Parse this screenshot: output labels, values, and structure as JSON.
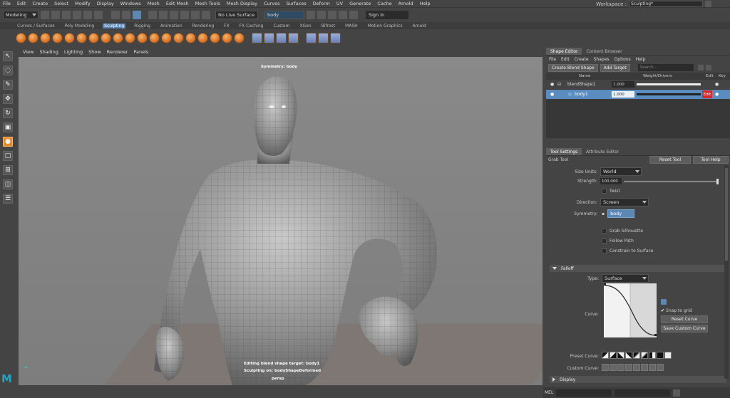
{
  "menubar": {
    "items": [
      "File",
      "Edit",
      "Create",
      "Select",
      "Modify",
      "Display",
      "Windows",
      "Mesh",
      "Edit Mesh",
      "Mesh Tools",
      "Mesh Display",
      "Curves",
      "Surfaces",
      "Deform",
      "UV",
      "Generate",
      "Cache",
      "Arnold",
      "Help"
    ],
    "workspace_label": "Workspace :",
    "workspace_value": "Sculpting*"
  },
  "statusline": {
    "mode": "Modeling",
    "live_surface": "No Live Surface",
    "symmetry_field": "body",
    "signin": "Sign In"
  },
  "shelf": {
    "tabs": [
      "Curves / Surfaces",
      "Poly Modeling",
      "Sculpting",
      "Rigging",
      "Animation",
      "Rendering",
      "FX",
      "FX Caching",
      "Custom",
      "XGen",
      "Bifrost",
      "MASH",
      "Motion Graphics",
      "Arnold"
    ],
    "active_tab": "Sculpting"
  },
  "viewport": {
    "menu": [
      "View",
      "Shading",
      "Lighting",
      "Show",
      "Renderer",
      "Panels"
    ],
    "hud_top": "Symmetry: body",
    "hud_line1": "Editing blend shape target: body1",
    "hud_line2": "Sculpting on: bodyShapeDeformed",
    "hud_line3": "persp"
  },
  "shape_editor": {
    "tabs": [
      "Shape Editor",
      "Content Browser"
    ],
    "menu": [
      "File",
      "Edit",
      "Create",
      "Shapes",
      "Options",
      "Help"
    ],
    "create_blend_shape": "Create Blend Shape",
    "add_target": "Add Target",
    "search_placeholder": "Search...",
    "col_name": "Name",
    "col_weight": "Weight/Drivers",
    "col_edit": "Edit",
    "col_key": "Key",
    "rows": [
      {
        "name": "blendShape1",
        "weight": "1.000"
      },
      {
        "name": "body1",
        "weight": "1.000",
        "edit": "Edit"
      }
    ]
  },
  "tool_settings": {
    "tabs": [
      "Tool Settings",
      "Attribute Editor"
    ],
    "tool_name": "Grab Tool",
    "reset_tool": "Reset Tool",
    "tool_help": "Tool Help",
    "size_units_label": "Size Units:",
    "size_units_value": "World",
    "strength_label": "Strength:",
    "strength_value": "100.000",
    "twist": "Twist",
    "direction_label": "Direction:",
    "direction_value": "Screen",
    "symmetry_label": "Symmetry:",
    "symmetry_value": "body",
    "grab_silhouette": "Grab Silhouette",
    "follow_path": "Follow Path",
    "constrain_surface": "Constrain to Surface",
    "falloff_section": "Falloff",
    "type_label": "Type:",
    "type_value": "Surface",
    "curve_label": "Curve:",
    "snap_to_grid": "Snap to grid",
    "reset_curve": "Reset Curve",
    "save_custom_curve": "Save Custom Curve",
    "preset_curve_label": "Preset Curve:",
    "custom_curve_label": "Custom Curve:",
    "display_section": "Display"
  },
  "cmdline": {
    "label": "MEL"
  }
}
